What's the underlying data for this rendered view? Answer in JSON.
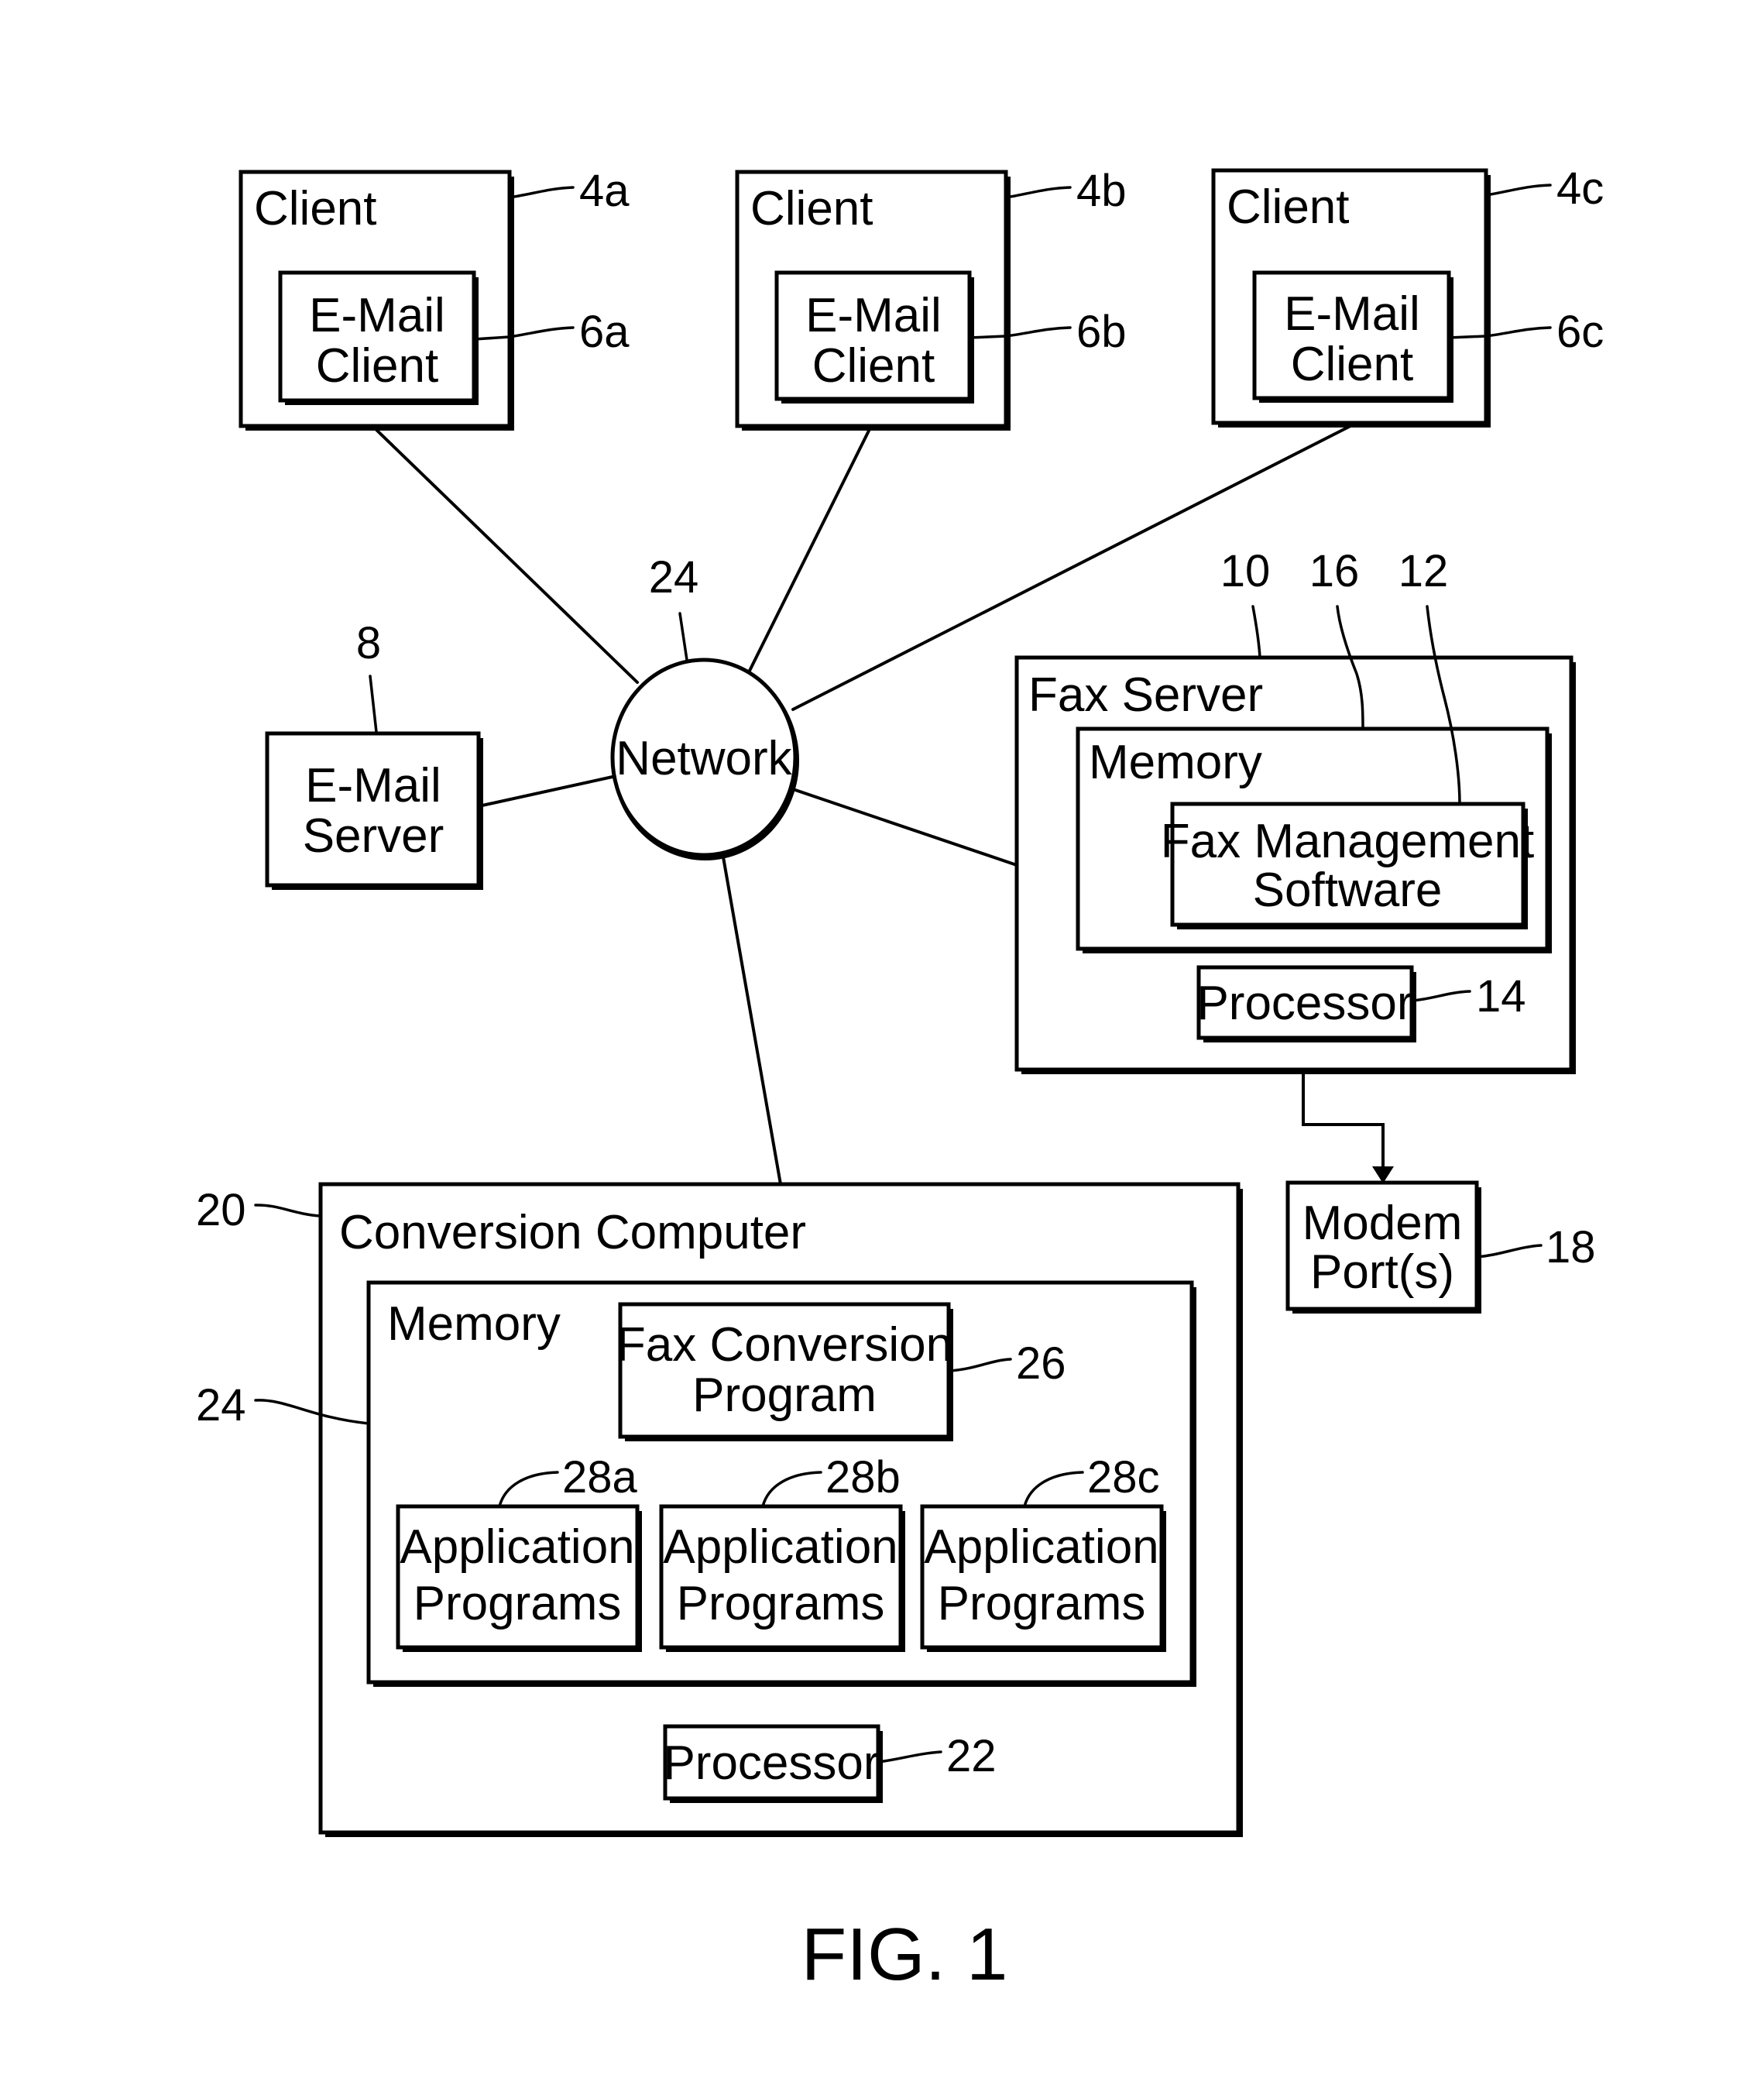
{
  "figure": {
    "caption": "FIG. 1",
    "background": "#ffffff",
    "ink": "#000000"
  },
  "network": {
    "label": "Network",
    "ref": "24"
  },
  "clients": [
    {
      "id": "4a",
      "title": "Client",
      "inner_line1": "E-Mail",
      "inner_line2": "Client",
      "ref": "4a",
      "inner_ref": "6a"
    },
    {
      "id": "4b",
      "title": "Client",
      "inner_line1": "E-Mail",
      "inner_line2": "Client",
      "ref": "4b",
      "inner_ref": "6b"
    },
    {
      "id": "4c",
      "title": "Client",
      "inner_line1": "E-Mail",
      "inner_line2": "Client",
      "ref": "4c",
      "inner_ref": "6c"
    }
  ],
  "email_server": {
    "line1": "E-Mail",
    "line2": "Server",
    "ref": "8"
  },
  "fax_server": {
    "title": "Fax Server",
    "ref": "10",
    "memory": {
      "title": "Memory",
      "ref": "16"
    },
    "software": {
      "line1": "Fax Management",
      "line2": "Software",
      "ref": "12"
    },
    "processor": {
      "label": "Processor",
      "ref": "14"
    }
  },
  "modem": {
    "line1": "Modem",
    "line2": "Port(s)",
    "ref": "18"
  },
  "conversion_computer": {
    "title": "Conversion Computer",
    "ref": "20",
    "memory": {
      "title": "Memory",
      "ref": "24"
    },
    "fax_conversion": {
      "line1": "Fax Conversion",
      "line2": "Program",
      "ref": "26"
    },
    "apps": [
      {
        "line1": "Application",
        "line2": "Programs",
        "ref": "28a"
      },
      {
        "line1": "Application",
        "line2": "Programs",
        "ref": "28b"
      },
      {
        "line1": "Application",
        "line2": "Programs",
        "ref": "28c"
      }
    ],
    "processor": {
      "label": "Processor",
      "ref": "22"
    }
  }
}
